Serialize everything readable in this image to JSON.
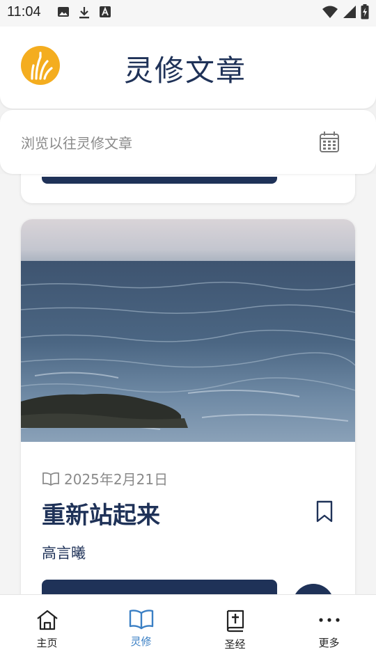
{
  "status_bar": {
    "time": "11:04",
    "icons_left": [
      "image-icon",
      "download-icon",
      "a-box-icon"
    ],
    "icons_right": [
      "wifi-icon",
      "signal-icon",
      "battery-charging-icon"
    ]
  },
  "header": {
    "title": "灵修文章",
    "logo_color": "#f4ad1f"
  },
  "browse": {
    "placeholder": "浏览以往灵修文章",
    "icon": "calendar-icon"
  },
  "article": {
    "date": "2025年2月21日",
    "title": "重新站起来",
    "author": "高言曦",
    "image": "ocean-waves-photo"
  },
  "bottom_nav": {
    "items": [
      {
        "label": "主页",
        "icon": "home-icon",
        "active": false
      },
      {
        "label": "灵修",
        "icon": "open-book-icon",
        "active": true
      },
      {
        "label": "圣经",
        "icon": "bible-icon",
        "active": false
      },
      {
        "label": "更多",
        "icon": "more-icon",
        "active": false
      }
    ]
  },
  "colors": {
    "primary": "#1f3258",
    "accent_active": "#3a7fc4",
    "muted_text": "#8a8a8a"
  }
}
